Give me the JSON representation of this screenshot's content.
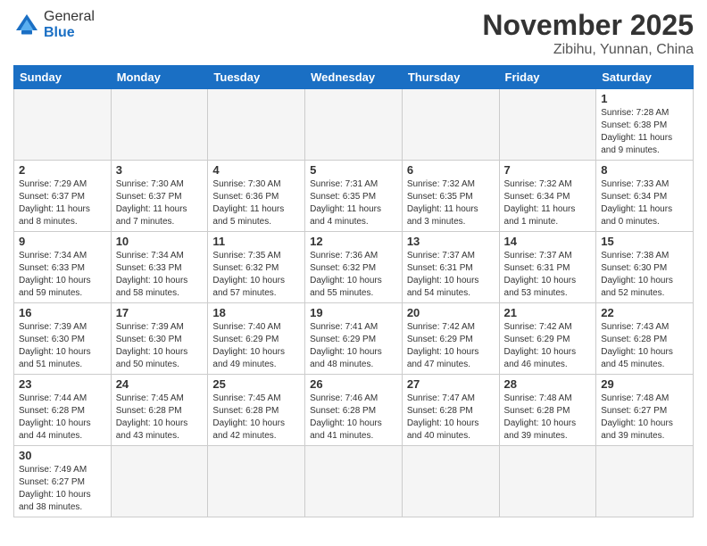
{
  "header": {
    "logo_general": "General",
    "logo_blue": "Blue",
    "title": "November 2025",
    "subtitle": "Zibihu, Yunnan, China"
  },
  "weekdays": [
    "Sunday",
    "Monday",
    "Tuesday",
    "Wednesday",
    "Thursday",
    "Friday",
    "Saturday"
  ],
  "weeks": [
    [
      {
        "day": "",
        "info": "",
        "empty": true
      },
      {
        "day": "",
        "info": "",
        "empty": true
      },
      {
        "day": "",
        "info": "",
        "empty": true
      },
      {
        "day": "",
        "info": "",
        "empty": true
      },
      {
        "day": "",
        "info": "",
        "empty": true
      },
      {
        "day": "",
        "info": "",
        "empty": true
      },
      {
        "day": "1",
        "info": "Sunrise: 7:28 AM\nSunset: 6:38 PM\nDaylight: 11 hours\nand 9 minutes."
      }
    ],
    [
      {
        "day": "2",
        "info": "Sunrise: 7:29 AM\nSunset: 6:37 PM\nDaylight: 11 hours\nand 8 minutes."
      },
      {
        "day": "3",
        "info": "Sunrise: 7:30 AM\nSunset: 6:37 PM\nDaylight: 11 hours\nand 7 minutes."
      },
      {
        "day": "4",
        "info": "Sunrise: 7:30 AM\nSunset: 6:36 PM\nDaylight: 11 hours\nand 5 minutes."
      },
      {
        "day": "5",
        "info": "Sunrise: 7:31 AM\nSunset: 6:35 PM\nDaylight: 11 hours\nand 4 minutes."
      },
      {
        "day": "6",
        "info": "Sunrise: 7:32 AM\nSunset: 6:35 PM\nDaylight: 11 hours\nand 3 minutes."
      },
      {
        "day": "7",
        "info": "Sunrise: 7:32 AM\nSunset: 6:34 PM\nDaylight: 11 hours\nand 1 minute."
      },
      {
        "day": "8",
        "info": "Sunrise: 7:33 AM\nSunset: 6:34 PM\nDaylight: 11 hours\nand 0 minutes."
      }
    ],
    [
      {
        "day": "9",
        "info": "Sunrise: 7:34 AM\nSunset: 6:33 PM\nDaylight: 10 hours\nand 59 minutes."
      },
      {
        "day": "10",
        "info": "Sunrise: 7:34 AM\nSunset: 6:33 PM\nDaylight: 10 hours\nand 58 minutes."
      },
      {
        "day": "11",
        "info": "Sunrise: 7:35 AM\nSunset: 6:32 PM\nDaylight: 10 hours\nand 57 minutes."
      },
      {
        "day": "12",
        "info": "Sunrise: 7:36 AM\nSunset: 6:32 PM\nDaylight: 10 hours\nand 55 minutes."
      },
      {
        "day": "13",
        "info": "Sunrise: 7:37 AM\nSunset: 6:31 PM\nDaylight: 10 hours\nand 54 minutes."
      },
      {
        "day": "14",
        "info": "Sunrise: 7:37 AM\nSunset: 6:31 PM\nDaylight: 10 hours\nand 53 minutes."
      },
      {
        "day": "15",
        "info": "Sunrise: 7:38 AM\nSunset: 6:30 PM\nDaylight: 10 hours\nand 52 minutes."
      }
    ],
    [
      {
        "day": "16",
        "info": "Sunrise: 7:39 AM\nSunset: 6:30 PM\nDaylight: 10 hours\nand 51 minutes."
      },
      {
        "day": "17",
        "info": "Sunrise: 7:39 AM\nSunset: 6:30 PM\nDaylight: 10 hours\nand 50 minutes."
      },
      {
        "day": "18",
        "info": "Sunrise: 7:40 AM\nSunset: 6:29 PM\nDaylight: 10 hours\nand 49 minutes."
      },
      {
        "day": "19",
        "info": "Sunrise: 7:41 AM\nSunset: 6:29 PM\nDaylight: 10 hours\nand 48 minutes."
      },
      {
        "day": "20",
        "info": "Sunrise: 7:42 AM\nSunset: 6:29 PM\nDaylight: 10 hours\nand 47 minutes."
      },
      {
        "day": "21",
        "info": "Sunrise: 7:42 AM\nSunset: 6:29 PM\nDaylight: 10 hours\nand 46 minutes."
      },
      {
        "day": "22",
        "info": "Sunrise: 7:43 AM\nSunset: 6:28 PM\nDaylight: 10 hours\nand 45 minutes."
      }
    ],
    [
      {
        "day": "23",
        "info": "Sunrise: 7:44 AM\nSunset: 6:28 PM\nDaylight: 10 hours\nand 44 minutes."
      },
      {
        "day": "24",
        "info": "Sunrise: 7:45 AM\nSunset: 6:28 PM\nDaylight: 10 hours\nand 43 minutes."
      },
      {
        "day": "25",
        "info": "Sunrise: 7:45 AM\nSunset: 6:28 PM\nDaylight: 10 hours\nand 42 minutes."
      },
      {
        "day": "26",
        "info": "Sunrise: 7:46 AM\nSunset: 6:28 PM\nDaylight: 10 hours\nand 41 minutes."
      },
      {
        "day": "27",
        "info": "Sunrise: 7:47 AM\nSunset: 6:28 PM\nDaylight: 10 hours\nand 40 minutes."
      },
      {
        "day": "28",
        "info": "Sunrise: 7:48 AM\nSunset: 6:28 PM\nDaylight: 10 hours\nand 39 minutes."
      },
      {
        "day": "29",
        "info": "Sunrise: 7:48 AM\nSunset: 6:27 PM\nDaylight: 10 hours\nand 39 minutes."
      }
    ],
    [
      {
        "day": "30",
        "info": "Sunrise: 7:49 AM\nSunset: 6:27 PM\nDaylight: 10 hours\nand 38 minutes."
      },
      {
        "day": "",
        "info": "",
        "empty": true
      },
      {
        "day": "",
        "info": "",
        "empty": true
      },
      {
        "day": "",
        "info": "",
        "empty": true
      },
      {
        "day": "",
        "info": "",
        "empty": true
      },
      {
        "day": "",
        "info": "",
        "empty": true
      },
      {
        "day": "",
        "info": "",
        "empty": true
      }
    ]
  ]
}
